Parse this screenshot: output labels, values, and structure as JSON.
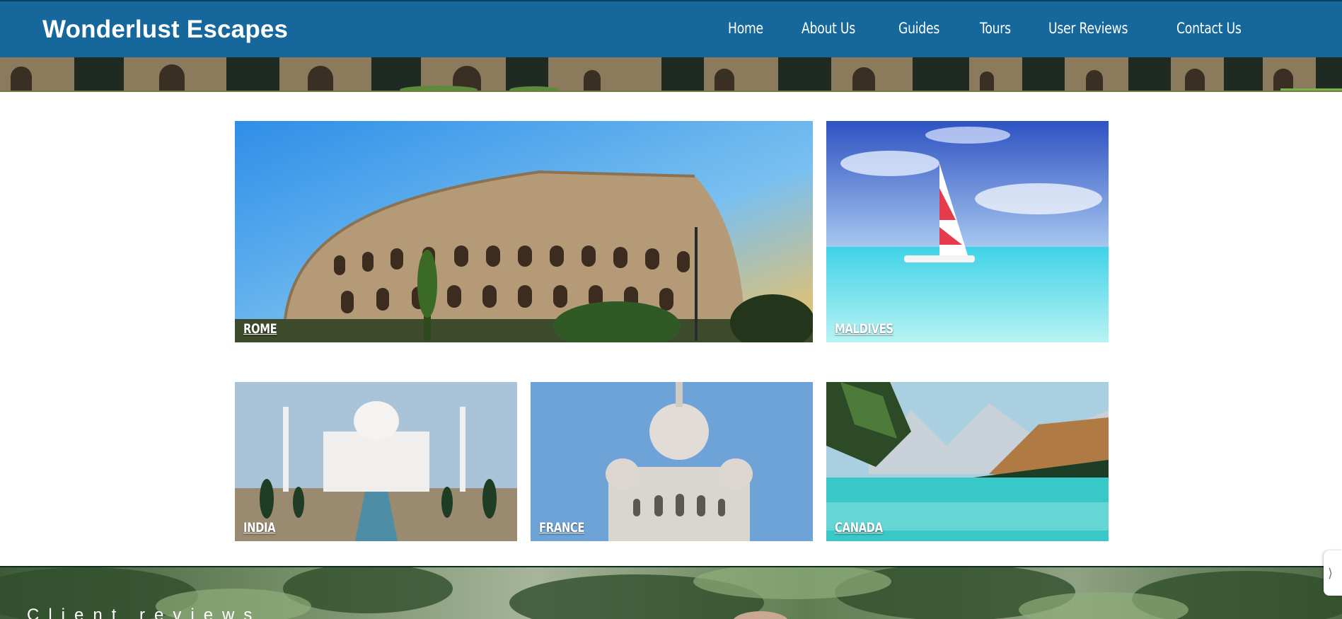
{
  "header": {
    "brand": "Wonderlust Escapes",
    "nav": [
      {
        "label": "Home"
      },
      {
        "label": "About Us"
      },
      {
        "label": "Guides"
      },
      {
        "label": "Tours"
      },
      {
        "label": "User Reviews"
      },
      {
        "label": "Contact Us"
      }
    ]
  },
  "destinations": [
    {
      "label": "ROME"
    },
    {
      "label": "MALDIVES"
    },
    {
      "label": "INDIA"
    },
    {
      "label": "FRANCE"
    },
    {
      "label": "CANADA"
    }
  ],
  "reviews": {
    "title": "Client reviews"
  },
  "side_handle": {
    "icon": "expand-icon"
  },
  "colors": {
    "nav_bg": "#16679c",
    "text": "#ffffff"
  }
}
